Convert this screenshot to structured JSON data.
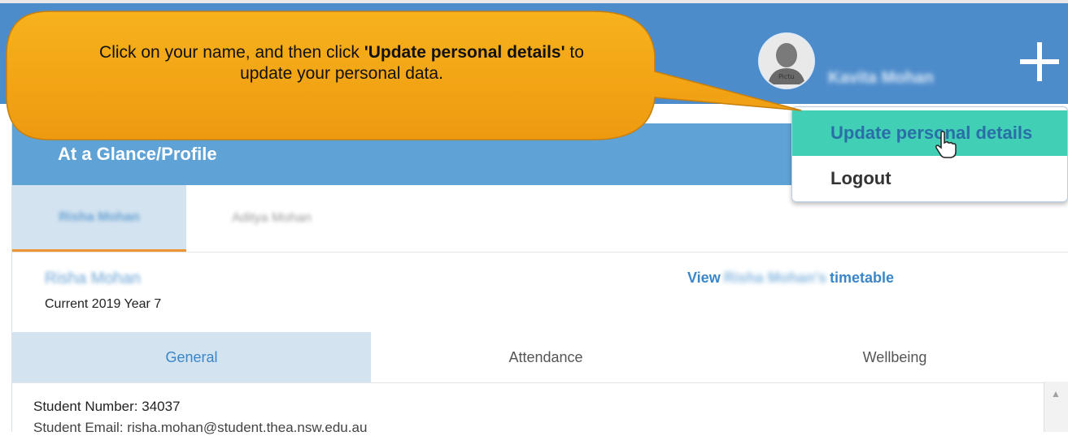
{
  "header": {
    "user_name": "Kavita Mohan",
    "avatar_label": "Pictu",
    "plus_icon": "plus-icon"
  },
  "user_menu": {
    "items": [
      {
        "label": "Update personal details",
        "highlighted": true
      },
      {
        "label": "Logout",
        "highlighted": false
      }
    ],
    "cursor_icon": "hand-pointer-icon"
  },
  "callout": {
    "part1": "Click on your name, and then click ",
    "bold": "'Update personal details'",
    "part2": " to update your personal data.",
    "color": "#f5a817"
  },
  "panel": {
    "title": "At a Glance/Profile",
    "children_tabs": [
      {
        "label": "Risha Mohan",
        "active": true
      },
      {
        "label": "Aditya Mohan",
        "active": false
      }
    ],
    "student": {
      "name": "Risha Mohan",
      "enrolment": "Current 2019 Year 7",
      "timetable_link": {
        "prefix": "View",
        "name": "Risha Mohan's",
        "suffix": "timetable"
      }
    },
    "sub_tabs": [
      {
        "label": "General",
        "active": true
      },
      {
        "label": "Attendance",
        "active": false
      },
      {
        "label": "Wellbeing",
        "active": false
      }
    ],
    "details": {
      "student_number": "Student Number: 34037",
      "student_email": "Student Email: risha.mohan@student.thea.nsw.edu.au"
    }
  },
  "colors": {
    "header_bg": "#4d8ccb",
    "panel_header_bg": "#5fa2d6",
    "menu_highlight": "#41d0b6",
    "active_tab_bg": "#d3e3f0",
    "active_tab_underline": "#ef9333"
  }
}
